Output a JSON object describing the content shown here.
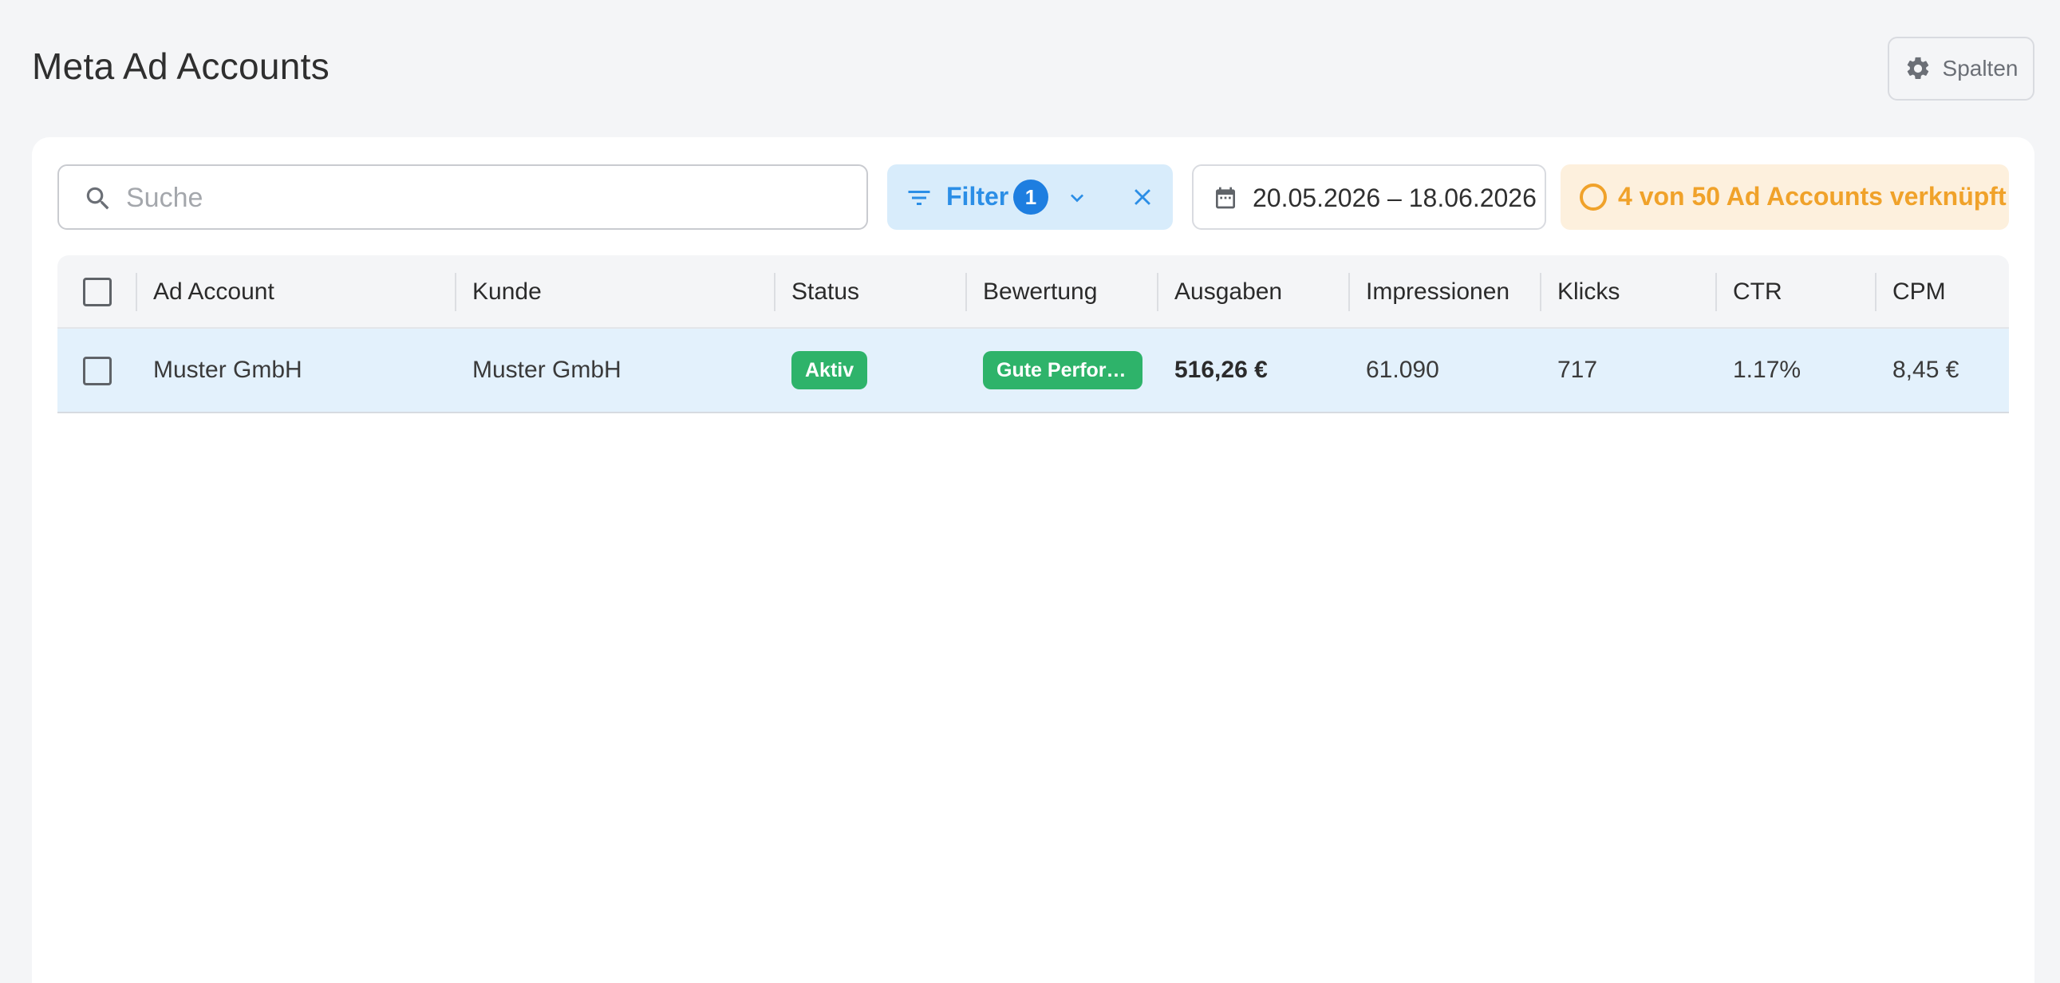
{
  "page": {
    "title": "Meta Ad Accounts",
    "columns_button_label": "Spalten"
  },
  "toolbar": {
    "search_placeholder": "Suche",
    "search_value": "",
    "filter_label": "Filter",
    "filter_count": "1",
    "date_range": "20.05.2026 – 18.06.2026",
    "linked_status": "4 von 50 Ad Accounts verknüpft"
  },
  "colors": {
    "accent_blue": "#1e7ee0",
    "filter_bg": "#d8ecfb",
    "warning_orange": "#f0a22a",
    "success_green": "#2eb36a",
    "selected_row_bg": "#e3f1fc"
  },
  "table": {
    "headers": {
      "ad_account": "Ad Account",
      "kunde": "Kunde",
      "status": "Status",
      "bewertung": "Bewertung",
      "ausgaben": "Ausgaben",
      "impressionen": "Impressionen",
      "klicks": "Klicks",
      "ctr": "CTR",
      "cpm": "CPM"
    },
    "rows": [
      {
        "ad_account": "Muster GmbH",
        "kunde": "Muster GmbH",
        "status": "Aktiv",
        "bewertung": "Gute Perfor…",
        "ausgaben": "516,26 €",
        "impressionen": "61.090",
        "klicks": "717",
        "ctr": "1.17%",
        "cpm": "8,45 €"
      }
    ]
  },
  "icons": {
    "columns": "gear-icon",
    "search": "search-icon",
    "filter": "filter-icon",
    "filter_expand": "chevron-down-icon",
    "filter_clear": "close-icon",
    "date": "calendar-icon",
    "linked_status": "circle-outline-icon"
  }
}
